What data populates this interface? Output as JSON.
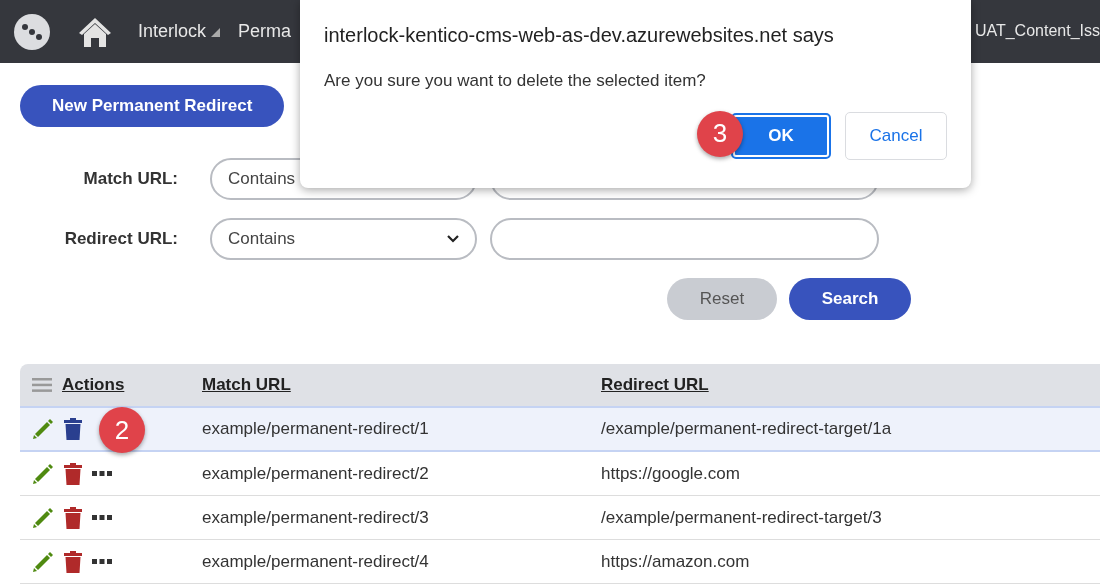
{
  "navbar": {
    "items": [
      {
        "label": "Interlock",
        "kind": "dropdown"
      },
      {
        "label": "Perma",
        "kind": "link"
      }
    ],
    "user": "UAT_Content_Iss"
  },
  "new_button": "New Permanent Redirect",
  "filters": [
    {
      "label": "Match URL:",
      "operator": "Contains"
    },
    {
      "label": "Redirect URL:",
      "operator": "Contains"
    }
  ],
  "filter_buttons": {
    "reset": "Reset",
    "search": "Search"
  },
  "table": {
    "columns": [
      "Actions",
      "Match URL",
      "Redirect URL"
    ],
    "rows": [
      {
        "selected": true,
        "step": "2",
        "match_url": "example/permanent-redirect/1",
        "redirect_url": "/example/permanent-redirect-target/1a"
      },
      {
        "selected": false,
        "match_url": "example/permanent-redirect/2",
        "redirect_url": "https://google.com"
      },
      {
        "selected": false,
        "match_url": "example/permanent-redirect/3",
        "redirect_url": "/example/permanent-redirect-target/3"
      },
      {
        "selected": false,
        "match_url": "example/permanent-redirect/4",
        "redirect_url": "https://amazon.com"
      }
    ]
  },
  "dialog": {
    "title": "interlock-kentico-cms-web-as-dev.azurewebsites.net says",
    "message": "Are you sure you want to delete the selected item?",
    "ok": "OK",
    "cancel": "Cancel",
    "step": "3"
  }
}
